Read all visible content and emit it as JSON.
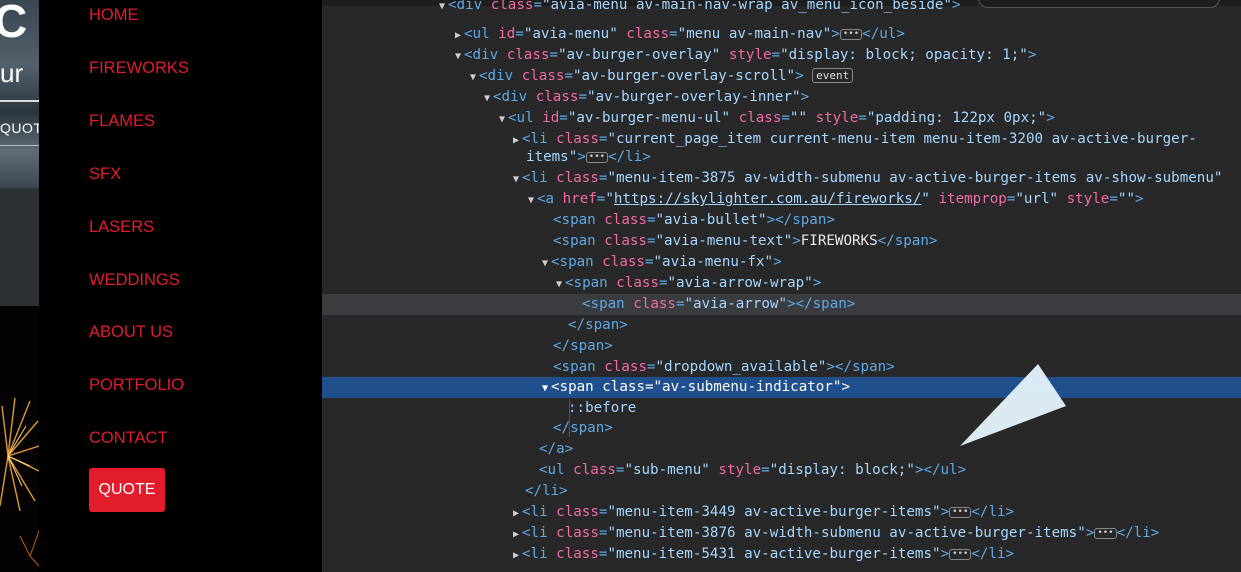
{
  "site": {
    "hero_letter": "C",
    "hero_word": "ur",
    "hero_quote": "QUOT"
  },
  "menu": {
    "items": [
      {
        "label": "HOME"
      },
      {
        "label": "FIREWORKS"
      },
      {
        "label": "FLAMES"
      },
      {
        "label": "SFX"
      },
      {
        "label": "LASERS"
      },
      {
        "label": "WEDDINGS"
      },
      {
        "label": "ABOUT US"
      },
      {
        "label": "PORTFOLIO"
      },
      {
        "label": "CONTACT"
      }
    ],
    "quote_label": "QUOTE",
    "accent_color": "#e21b2d"
  },
  "devtools": {
    "lines": {
      "l0_tag_open": "<div ",
      "l0_attr": "class",
      "l0_val": "\"avia-menu av-main-nav-wrap av_menu_icon_beside\"",
      "l0_close": ">",
      "l1_tag": "<ul ",
      "l1_attr1": "id",
      "l1_val1": "\"avia-menu\"",
      "l1_attr2": "class",
      "l1_val2": "\"menu av-main-nav\"",
      "l1_close": "</ul>",
      "l2_tag": "<div ",
      "l2_attr1": "class",
      "l2_val1": "\"av-burger-overlay\"",
      "l2_attr2": "style",
      "l2_val2": "\"display: block; opacity: 1;\"",
      "l3_tag": "<div ",
      "l3_attr": "class",
      "l3_val": "\"av-burger-overlay-scroll\"",
      "l3_badge": "event",
      "l4_tag": "<div ",
      "l4_attr": "class",
      "l4_val": "\"av-burger-overlay-inner\"",
      "l5_tag": "<ul ",
      "l5_attr1": "id",
      "l5_val1": "\"av-burger-menu-ul\"",
      "l5_attr2": "class",
      "l5_val2": "\"\"",
      "l5_attr3": "style",
      "l5_val3": "\"padding: 122px 0px;\"",
      "l6_tag": "<li ",
      "l6_attr": "class",
      "l6_val": "\"current_page_item current-menu-item menu-item-3200 av-active-burger-",
      "l7_val": "items\"",
      "l7_close": "</li>",
      "l8_tag": "<li ",
      "l8_attr": "class",
      "l8_val": "\"menu-item-3875 av-width-submenu av-active-burger-items av-show-submenu\"",
      "l9_tag": "<a ",
      "l9_attr1": "href",
      "l9_url": "https://skylighter.com.au/fireworks/",
      "l9_attr2": "itemprop",
      "l9_val2": "\"url\"",
      "l9_attr3": "style",
      "l9_val3": "\"\"",
      "l10_tag": "<span ",
      "l10_attr": "class",
      "l10_val": "\"avia-bullet\"",
      "l10_close": "</span>",
      "l11_tag": "<span ",
      "l11_attr": "class",
      "l11_val": "\"avia-menu-text\"",
      "l11_text": "FIREWORKS",
      "l11_close": "</span>",
      "l12_tag": "<span ",
      "l12_attr": "class",
      "l12_val": "\"avia-menu-fx\"",
      "l13_tag": "<span ",
      "l13_attr": "class",
      "l13_val": "\"avia-arrow-wrap\"",
      "l14_tag": "<span ",
      "l14_attr": "class",
      "l14_val": "\"avia-arrow\"",
      "l14_close": "</span>",
      "l15_close": "</span>",
      "l16_close": "</span>",
      "l17_tag": "<span ",
      "l17_attr": "class",
      "l17_val": "\"dropdown_available\"",
      "l17_close": "</span>",
      "l18_tag": "<span ",
      "l18_attr": "class",
      "l18_val": "\"av-submenu-indicator\"",
      "l19_pseudo": "::before",
      "l20_close": "</span>",
      "l21_close": "</a>",
      "l22_tag": "<ul ",
      "l22_attr1": "class",
      "l22_val1": "\"sub-menu\"",
      "l22_attr2": "style",
      "l22_val2": "\"display: block;\"",
      "l22_close": "</ul>",
      "l23_close": "</li>",
      "l24_tag": "<li ",
      "l24_attr": "class",
      "l24_val": "\"menu-item-3449 av-active-burger-items\"",
      "l24_close": "</li>",
      "l25_tag": "<li ",
      "l25_attr": "class",
      "l25_val": "\"menu-item-3876 av-width-submenu av-active-burger-items\"",
      "l25_close": "</li>",
      "l26_tag": "<li ",
      "l26_attr": "class",
      "l26_val": "\"menu-item-5431 av-active-burger-items\"",
      "l26_close": "</li>"
    }
  }
}
